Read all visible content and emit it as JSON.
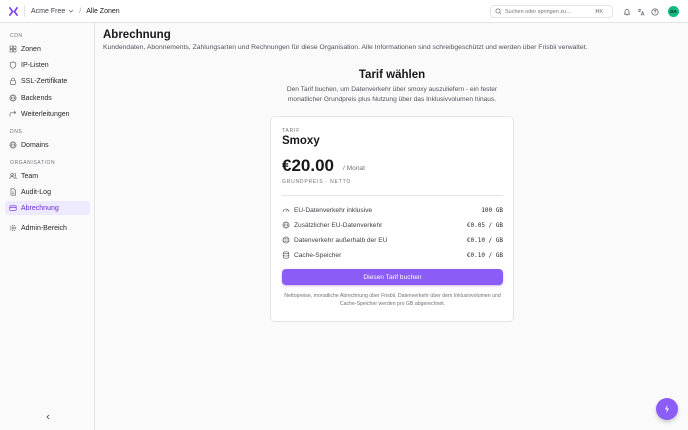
{
  "topbar": {
    "org": "Acme Free",
    "separator": "/",
    "current": "Alle Zonen",
    "search_placeholder": "Suchen oder springen zu…",
    "search_shortcut": "⌘K",
    "avatar_initials": "DA"
  },
  "sidebar": {
    "sections": {
      "cdn": "CDN",
      "dns": "DNS",
      "organisation": "ORGANISATION"
    },
    "items": {
      "zonen": "Zonen",
      "ip_listen": "IP-Listen",
      "ssl": "SSL-Zertifikate",
      "backends": "Backends",
      "weiterleitungen": "Weiterleitungen",
      "domains": "Domains",
      "team": "Team",
      "audit": "Audit-Log",
      "abrechnung": "Abrechnung",
      "admin": "Admin-Bereich"
    }
  },
  "page": {
    "title": "Abrechnung",
    "subtitle": "Kundendaten, Abonnements, Zahlungsarten und Rechnungen für diese Organisation. Alle Informationen sind schreibgeschützt und werden über Frisbii verwaltet."
  },
  "choose": {
    "title": "Tarif wählen",
    "description": "Den Tarif buchen, um Datenverkehr über smoxy auszuliefern - ein fester monatlicher Grundpreis plus Nutzung über das Inklusivvolumen hinaus."
  },
  "plan": {
    "label": "TARIF",
    "name": "Smoxy",
    "price": "€20.00",
    "period": "/ Monat",
    "price_note": "GRUNDPREIS · NETTO",
    "features": [
      {
        "icon": "gauge-icon",
        "label": "EU-Datenverkehr inklusive",
        "value": "100 GB"
      },
      {
        "icon": "globe-icon",
        "label": "Zusätzlicher EU-Datenverkehr",
        "value": "€0.05 / GB"
      },
      {
        "icon": "globe-alt-icon",
        "label": "Datenverkehr außerhalb der EU",
        "value": "€0.10 / GB"
      },
      {
        "icon": "database-icon",
        "label": "Cache-Speicher",
        "value": "€0.10 / GB"
      }
    ],
    "button": "Diesen Tarif buchen",
    "fineprint": "Nettopreise, monatliche Abrechnung über Frisbii. Datenverkehr über dem Inklusivvolumen und Cache-Speicher werden pro GB abgerechnet."
  },
  "colors": {
    "accent": "#8b5cf6",
    "accent_bg": "#ede9fe",
    "avatar": "#10b981"
  }
}
